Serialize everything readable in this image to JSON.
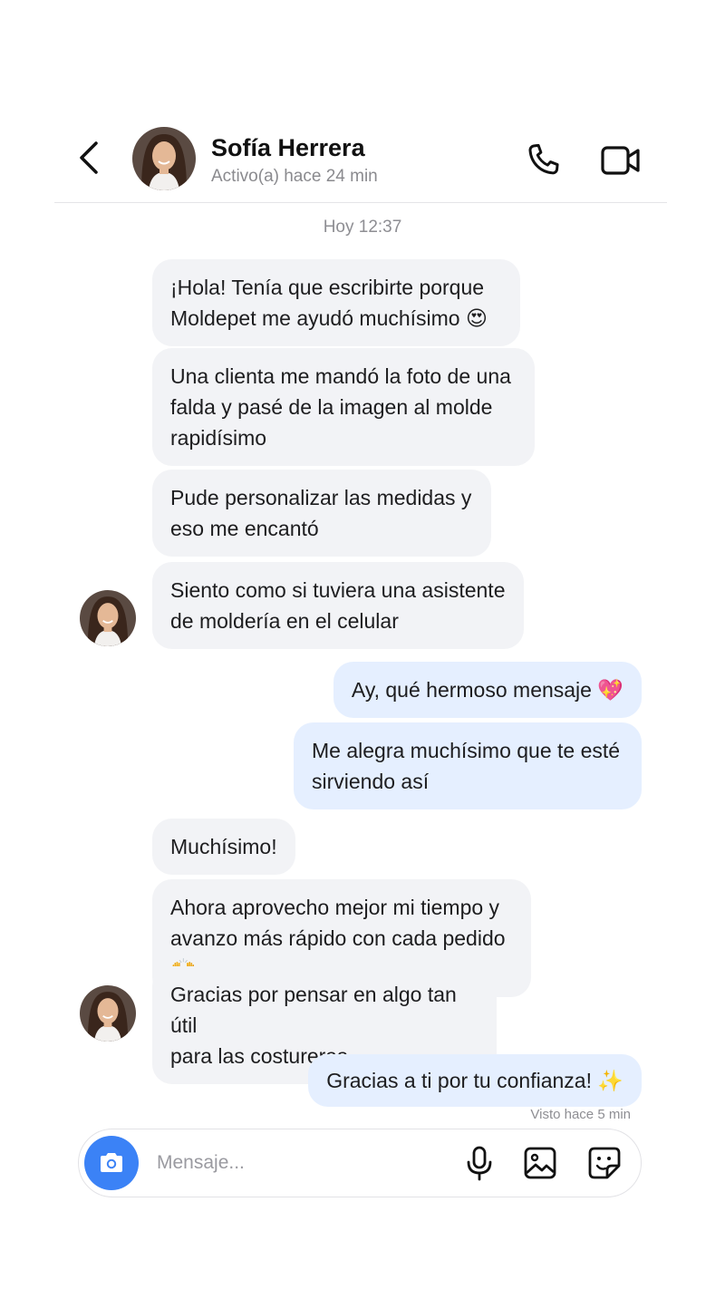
{
  "contact": {
    "name": "Sofía Herrera",
    "status": "Activo(a) hace 24 min"
  },
  "conversation": {
    "timestamp": "Hoy 12:37",
    "messages": [
      {
        "from": "them",
        "text": "¡Hola! Tenía que escribirte porque\nMoldepet me ayudó muchísimo 😍"
      },
      {
        "from": "them",
        "text": "Una clienta me mandó la foto de una\nfalda y pasé de la imagen al molde\nrapidísimo"
      },
      {
        "from": "them",
        "text": "Pude personalizar las medidas y\neso me encantó"
      },
      {
        "from": "them",
        "text": "Siento como si tuviera una asistente\nde moldería en el celular"
      },
      {
        "from": "me",
        "text": "Ay, qué hermoso mensaje 💖"
      },
      {
        "from": "me",
        "text": "Me alegra muchísimo que te esté\nsirviendo así"
      },
      {
        "from": "them",
        "text": "Muchísimo!"
      },
      {
        "from": "them",
        "text": "Ahora aprovecho mejor mi tiempo y\navanzo más rápido con cada pedido 🙌"
      },
      {
        "from": "them",
        "text": "Gracias por pensar en algo tan útil\npara las costureras"
      },
      {
        "from": "me",
        "text": "Gracias a ti por tu confianza! ✨"
      }
    ],
    "seen_status": "Visto hace 5 min"
  },
  "composer": {
    "placeholder": "Mensaje..."
  },
  "icons": {
    "back": "chevron-left-icon",
    "call": "phone-icon",
    "video": "video-camera-icon",
    "camera": "camera-icon",
    "mic": "microphone-icon",
    "gallery": "image-icon",
    "sticker": "sticker-icon"
  },
  "colors": {
    "accent": "#3b82f6",
    "incoming_bubble": "#f2f3f6",
    "outgoing_bubble": "#e5efff",
    "muted_text": "#8e8e93"
  }
}
